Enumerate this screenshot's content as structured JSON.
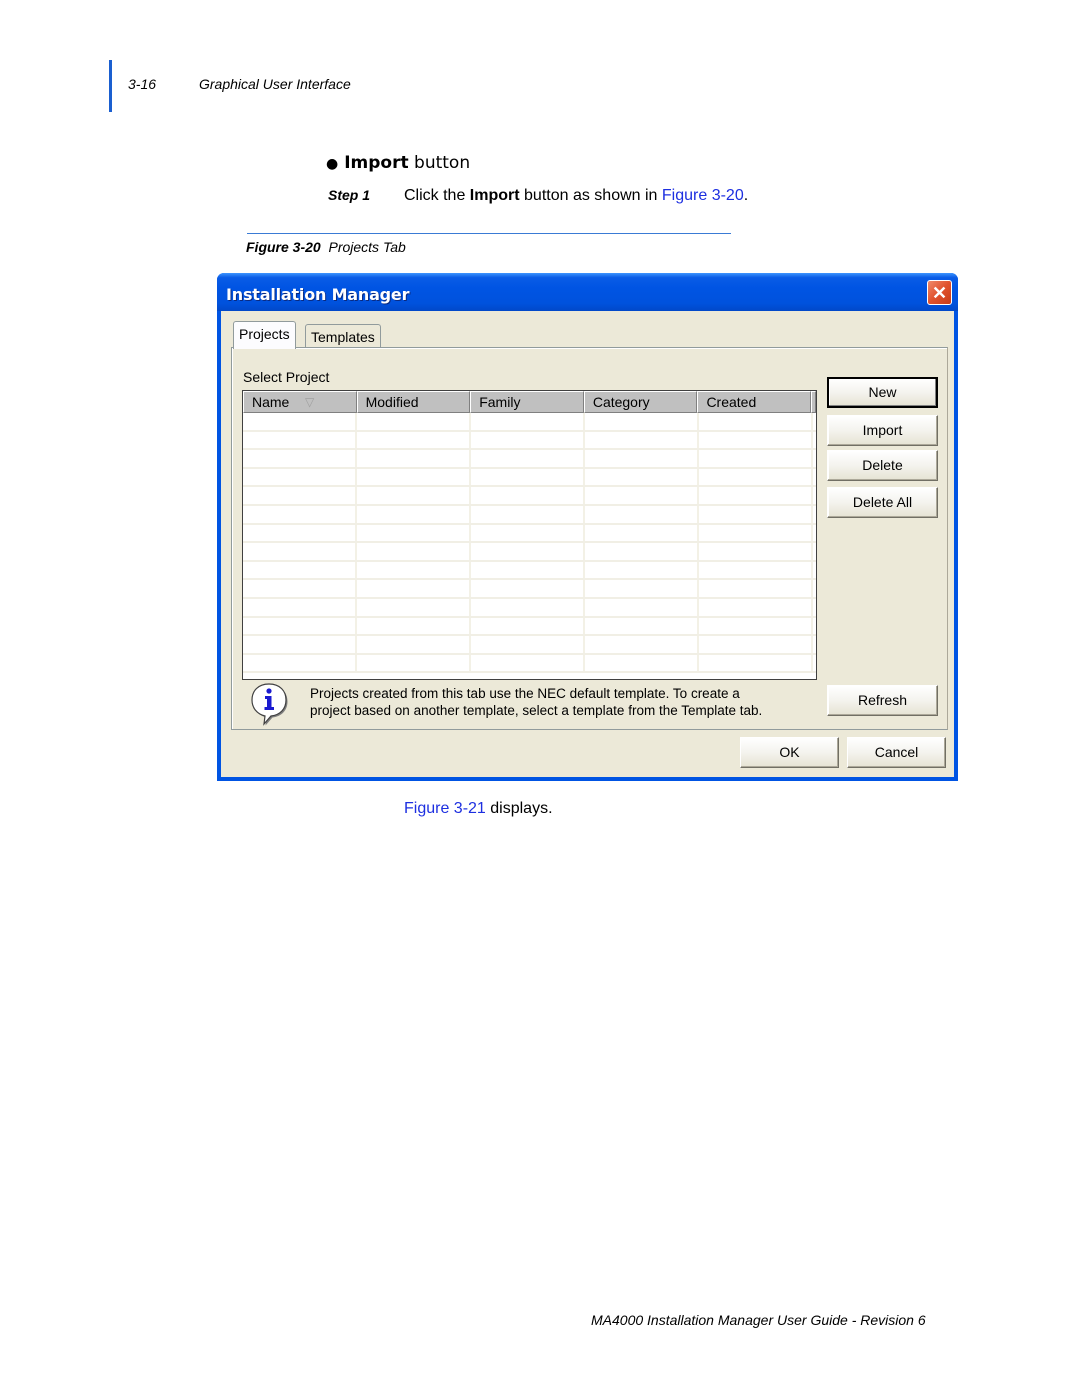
{
  "header": {
    "page_number": "3-16",
    "section_title": "Graphical User Interface"
  },
  "body": {
    "bullet": {
      "bold": "Import",
      "rest": " button"
    },
    "step": {
      "label": "Step  1",
      "text_before": "Click the ",
      "bold": "Import",
      "text_after": " button as shown in ",
      "link": "Figure 3-20",
      "end": "."
    },
    "figure_caption": {
      "number": "Figure 3-20",
      "title": "Projects Tab"
    },
    "after_figure": {
      "link": "Figure 3-21",
      "text": " displays."
    }
  },
  "dialog": {
    "title": "Installation Manager",
    "close_icon": "close-icon",
    "tabs": [
      {
        "label": "Projects",
        "active": true
      },
      {
        "label": "Templates",
        "active": false
      }
    ],
    "section_label": "Select Project",
    "table": {
      "columns": [
        "Name",
        "Modified",
        "Family",
        "Category",
        "Created"
      ],
      "sort_column": "Name",
      "sort_indicator": "▽",
      "rows": []
    },
    "side_buttons": {
      "new": "New",
      "import": "Import",
      "delete": "Delete",
      "delete_all": "Delete All",
      "refresh": "Refresh"
    },
    "info": {
      "icon": "info-icon",
      "line1": "Projects created from this tab use the NEC default template. To create a",
      "line2": "project based on another template, select a template from the Template tab."
    },
    "footer_buttons": {
      "ok": "OK",
      "cancel": "Cancel"
    }
  },
  "footer": {
    "text": "MA4000 Installation Manager User Guide - Revision 6"
  },
  "colors": {
    "link": "#1d2fe0",
    "margin_bar": "#1a5fd0",
    "titlebar": "#0054e3",
    "dialog_face": "#ece9d8",
    "close_button": "#e0522d"
  }
}
